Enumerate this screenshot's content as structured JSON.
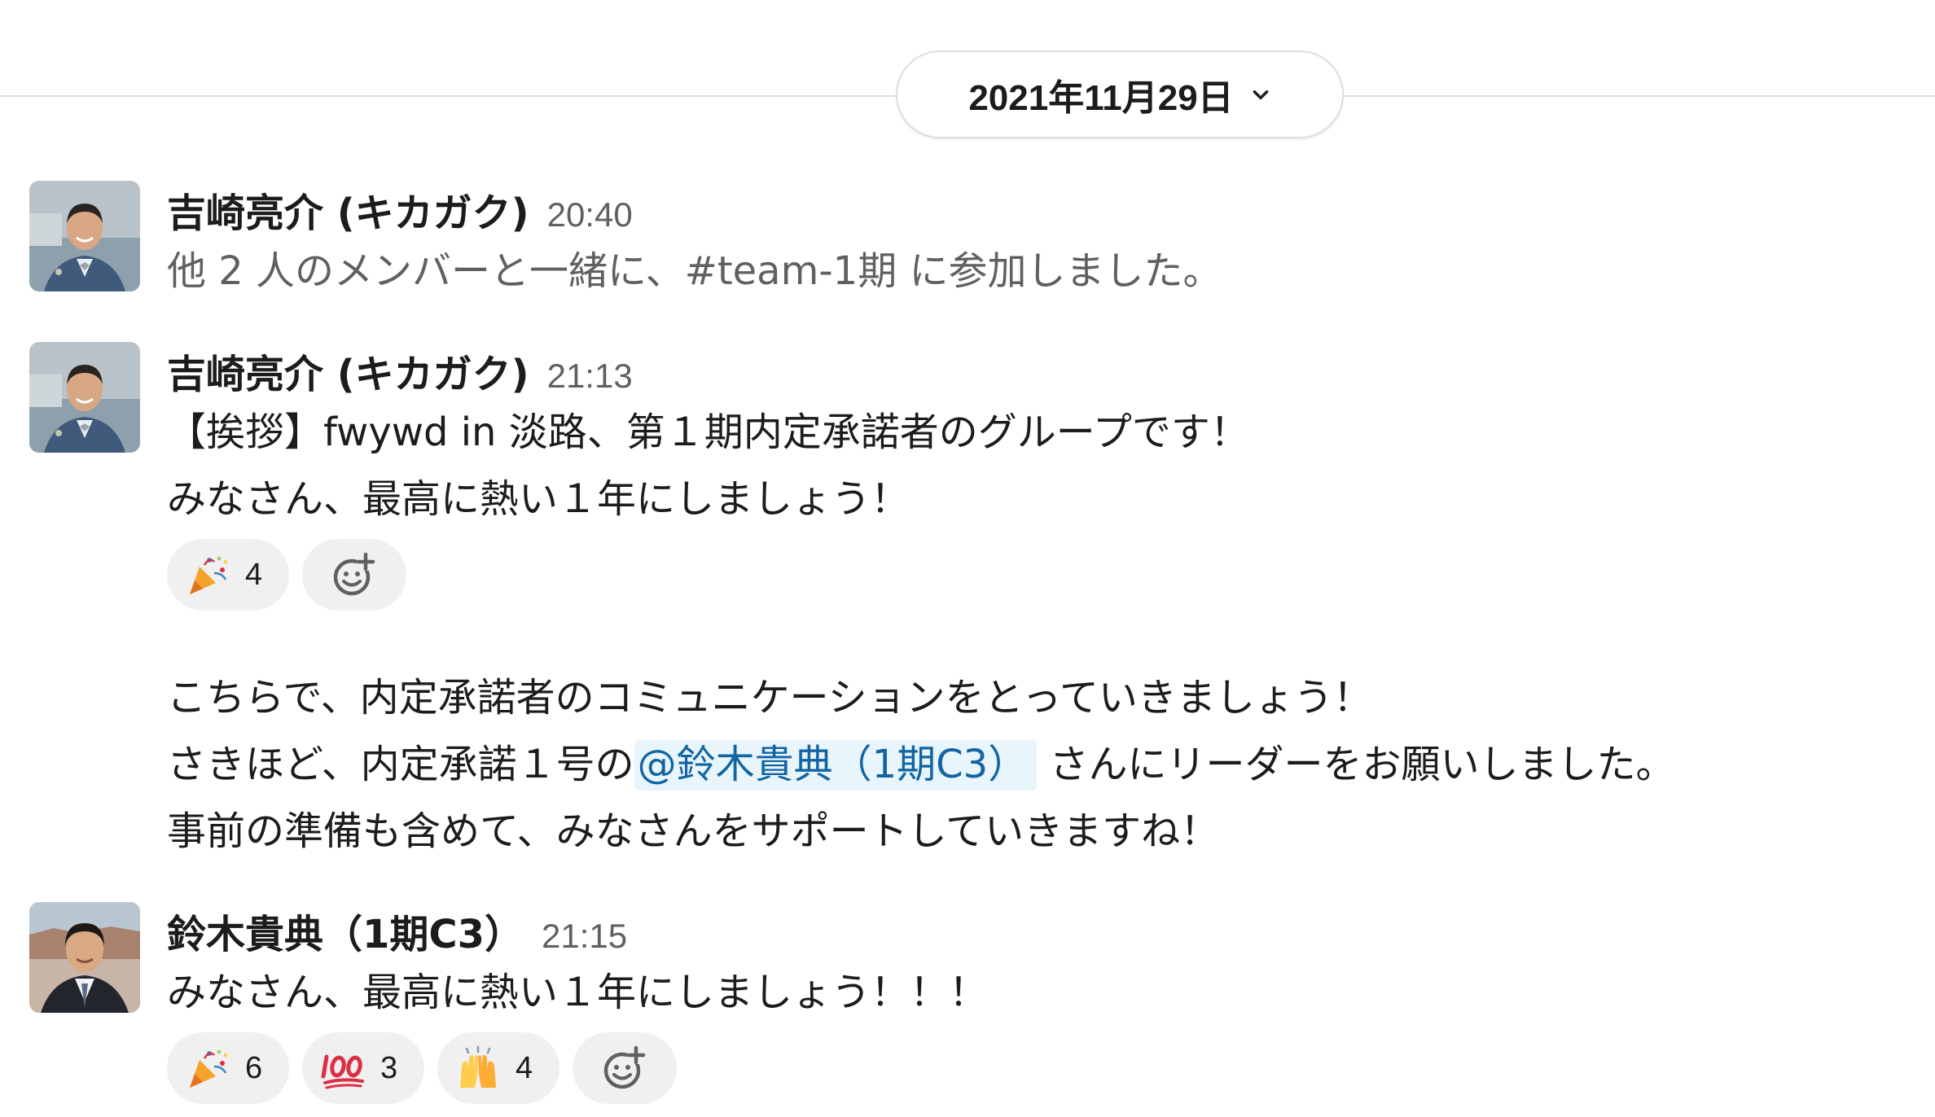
{
  "date_divider": {
    "label": "2021年11月29日",
    "chevron_icon": "chevron-down-icon"
  },
  "messages": [
    {
      "author": "吉崎亮介 (キカガク)",
      "time": "20:40",
      "lines": [
        "他 2 人のメンバーと一緒に、#team-1期 に参加しました。"
      ]
    },
    {
      "author": "吉崎亮介 (キカガク)",
      "time": "21:13",
      "lines": [
        "【挨拶】fwywd in 淡路、第１期内定承諾者のグループです！",
        "みなさん、最高に熱い１年にしましょう！"
      ],
      "reactions": [
        {
          "emoji": "party-popper",
          "count": "4"
        }
      ]
    },
    {
      "continuation": true,
      "lines": [
        "こちらで、内定承諾者のコミュニケーションをとっていきましょう！",
        {
          "before": "さきほど、内定承諾１号の",
          "mention": "@鈴木貴典（1期C3）",
          "after": " さんにリーダーをお願いしました。"
        },
        "事前の準備も含めて、みなさんをサポートしていきますね！"
      ]
    },
    {
      "author": "鈴木貴典（1期C3）",
      "time": "21:15",
      "lines": [
        "みなさん、最高に熱い１年にしましょう！！！"
      ],
      "reactions": [
        {
          "emoji": "party-popper",
          "count": "6"
        },
        {
          "emoji": "hundred-points",
          "count": "3"
        },
        {
          "emoji": "raising-hands",
          "count": "4"
        }
      ]
    }
  ],
  "icons": {
    "add_reaction": "add-reaction-icon"
  },
  "colors": {
    "text": "#1d1c1d",
    "muted": "#616061",
    "mention_text": "#1264a3",
    "mention_bg": "#e8f5fa",
    "reaction_bg": "#f0f0f0"
  }
}
